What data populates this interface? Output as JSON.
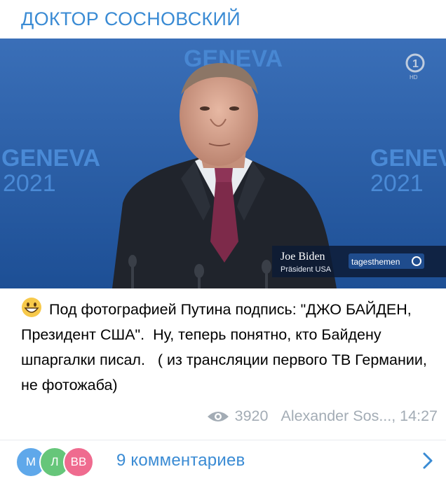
{
  "channel": {
    "name": "ДОКТОР СОСНОВСКИЙ"
  },
  "photo": {
    "backdrop_text": "GENEVA",
    "backdrop_year": "2021",
    "caption_name": "Joe Biden",
    "caption_title": "Präsident USA",
    "broadcaster_logo": "tagesthemen",
    "channel_logo": "1",
    "channel_logo_sub": "HD"
  },
  "message": {
    "emoji": "grinning-face-emoji",
    "text": "Под фотографией Путина подпись: \"ДЖО БАЙДЕН, Президент США\".  Ну, теперь понятно, кто Байдену шпаргалки писал.   ( из трансляции первого ТВ Германии, не фотожаба)"
  },
  "meta": {
    "views": "3920",
    "author_time": "Alexander Sos..., 14:27"
  },
  "comments": {
    "avatars": [
      {
        "initials": "М",
        "color": "#5fa8ea"
      },
      {
        "initials": "Л",
        "color": "#66c67a"
      },
      {
        "initials": "ВВ",
        "color": "#ef6b8f"
      }
    ],
    "label": "9 комментариев"
  },
  "colors": {
    "accent": "#3a8bd4",
    "meta": "#a3acb5"
  }
}
